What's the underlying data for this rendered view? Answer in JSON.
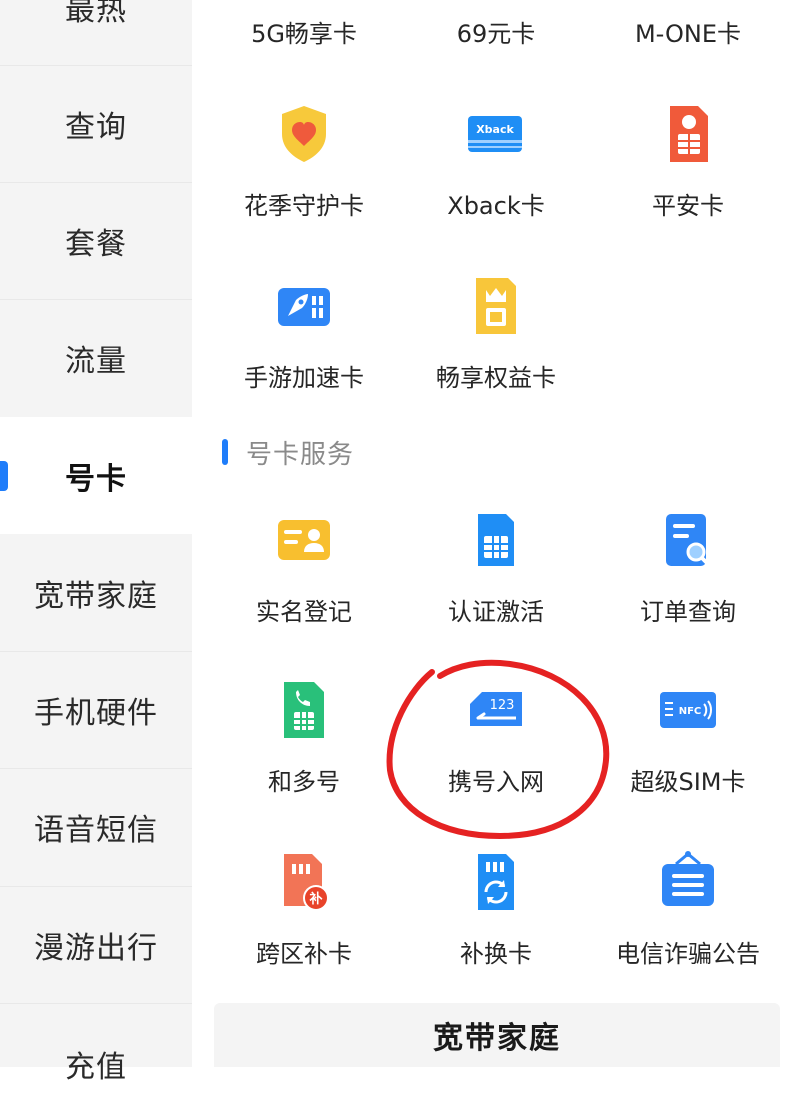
{
  "sidebar": {
    "items": [
      {
        "label": "最热"
      },
      {
        "label": "查询"
      },
      {
        "label": "套餐"
      },
      {
        "label": "流量"
      },
      {
        "label": "号卡"
      },
      {
        "label": "宽带家庭"
      },
      {
        "label": "手机硬件"
      },
      {
        "label": "语音短信"
      },
      {
        "label": "漫游出行"
      },
      {
        "label": "充值"
      }
    ],
    "active_index": 4
  },
  "cards_grid": {
    "items": [
      {
        "label": "5G畅享卡"
      },
      {
        "label": "69元卡"
      },
      {
        "label": "M-ONE卡"
      },
      {
        "label": "花季守护卡",
        "icon": "heart-shield-icon"
      },
      {
        "label": "Xback卡",
        "icon": "xback-card-icon",
        "icon_text": "Xback"
      },
      {
        "label": "平安卡",
        "icon": "safe-sim-icon"
      },
      {
        "label": "手游加速卡",
        "icon": "rocket-card-icon"
      },
      {
        "label": "畅享权益卡",
        "icon": "crown-sim-icon"
      }
    ]
  },
  "card_services": {
    "title": "号卡服务",
    "items": [
      {
        "label": "实名登记",
        "icon": "id-card-icon"
      },
      {
        "label": "认证激活",
        "icon": "sim-chip-icon"
      },
      {
        "label": "订单查询",
        "icon": "order-search-icon"
      },
      {
        "label": "和多号",
        "icon": "phone-sim-icon"
      },
      {
        "label": "携号入网",
        "icon": "number-transfer-icon",
        "icon_text": "123"
      },
      {
        "label": "超级SIM卡",
        "icon": "nfc-card-icon",
        "icon_text": "NFC"
      },
      {
        "label": "跨区补卡",
        "icon": "sim-replace-icon",
        "icon_text": "补"
      },
      {
        "label": "补换卡",
        "icon": "sim-swap-icon"
      },
      {
        "label": "电信诈骗公告",
        "icon": "notice-board-icon"
      }
    ]
  },
  "next_section": {
    "title": "宽带家庭"
  },
  "colors": {
    "accent": "#1f7dfa",
    "sidebar_bg": "#f4f4f4",
    "annotation": "#e52222"
  }
}
